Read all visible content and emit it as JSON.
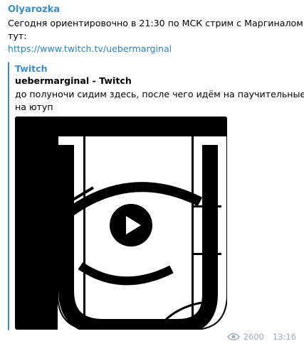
{
  "message": {
    "author": "Olyarozka",
    "text_lines": [
      "Сегодня ориентировочно в 21:30 по МСК стрим с Маргиналом",
      "тут:"
    ],
    "link": "https://www.twitch.tv/uebermarginal"
  },
  "preview": {
    "site_name": "Twitch",
    "title": "uebermarginal - Twitch",
    "description_lines": [
      "до полуночи сидим здесь, после чего идём на паучительные",
      "на ютуп"
    ],
    "accent_color": "#3a8ccc"
  },
  "footer": {
    "views": "2600",
    "time": "13:16",
    "views_icon": "eye-icon"
  },
  "colors": {
    "author": "#3a8ccc",
    "link": "#2a83c5",
    "meta": "#a0acb6"
  }
}
